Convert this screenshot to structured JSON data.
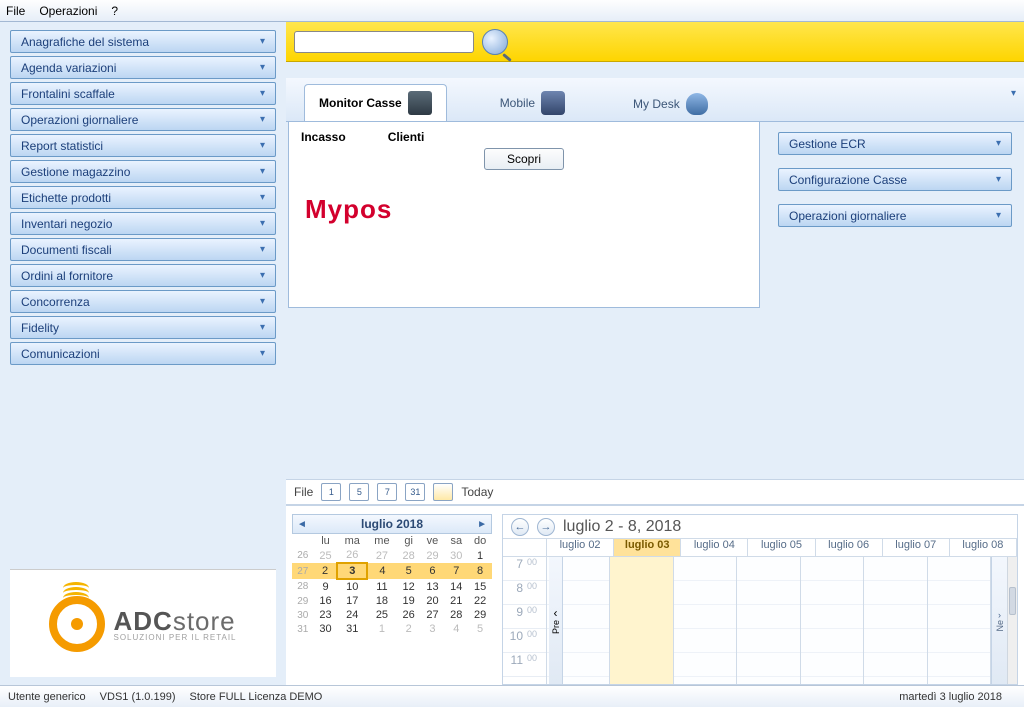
{
  "menu": {
    "file": "File",
    "operazioni": "Operazioni",
    "help": "?"
  },
  "sidebar": {
    "items": [
      "Anagrafiche del sistema",
      "Agenda variazioni",
      "Frontalini scaffale",
      "Operazioni giornaliere",
      "Report statistici",
      "Gestione magazzino",
      "Etichette prodotti",
      "Inventari negozio",
      "Documenti fiscali",
      "Ordini al fornitore",
      "Concorrenza",
      "Fidelity",
      "Comunicazioni"
    ]
  },
  "logo": {
    "brand_a": "ADC",
    "brand_b": "store",
    "sub": "SOLUZIONI PER IL RETAIL"
  },
  "search": {
    "placeholder": ""
  },
  "tabs": {
    "monitor": "Monitor Casse",
    "mobile": "Mobile",
    "mydesk": "My Desk"
  },
  "monitor": {
    "incasso": "Incasso",
    "clienti": "Clienti",
    "scopri": "Scopri",
    "mypos": "Mypos"
  },
  "right_panels": [
    "Gestione ECR",
    "Configurazione Casse",
    "Operazioni giornaliere"
  ],
  "cal_toolbar": {
    "file": "File",
    "d1": "1",
    "d5": "5",
    "d7": "7",
    "d31": "31",
    "today": "Today"
  },
  "mini_cal": {
    "title": "luglio  2018",
    "dow": [
      "lu",
      "ma",
      "me",
      "gi",
      "ve",
      "sa",
      "do"
    ],
    "rows": [
      {
        "wn": "26",
        "d": [
          "25",
          "26",
          "27",
          "28",
          "29",
          "30",
          "1"
        ],
        "dim": [
          0,
          1,
          2,
          3,
          4,
          5
        ]
      },
      {
        "wn": "27",
        "d": [
          "2",
          "3",
          "4",
          "5",
          "6",
          "7",
          "8"
        ],
        "sel": true,
        "today": 1
      },
      {
        "wn": "28",
        "d": [
          "9",
          "10",
          "11",
          "12",
          "13",
          "14",
          "15"
        ]
      },
      {
        "wn": "29",
        "d": [
          "16",
          "17",
          "18",
          "19",
          "20",
          "21",
          "22"
        ]
      },
      {
        "wn": "30",
        "d": [
          "23",
          "24",
          "25",
          "26",
          "27",
          "28",
          "29"
        ]
      },
      {
        "wn": "31",
        "d": [
          "30",
          "31",
          "1",
          "2",
          "3",
          "4",
          "5"
        ],
        "dim": [
          2,
          3,
          4,
          5,
          6
        ]
      }
    ]
  },
  "week": {
    "title": "luglio 2 - 8, 2018",
    "days": [
      "luglio 02",
      "luglio 03",
      "luglio 04",
      "luglio 05",
      "luglio 06",
      "luglio 07",
      "luglio 08"
    ],
    "today_index": 1,
    "hours": [
      "7",
      "8",
      "9",
      "10",
      "11"
    ],
    "minutes": "00",
    "prev": "Pre",
    "next": "Ne"
  },
  "status": {
    "user": "Utente generico",
    "ver": "VDS1 (1.0.199)",
    "lic": "Store FULL Licenza DEMO",
    "date": "martedì 3 luglio 2018"
  }
}
